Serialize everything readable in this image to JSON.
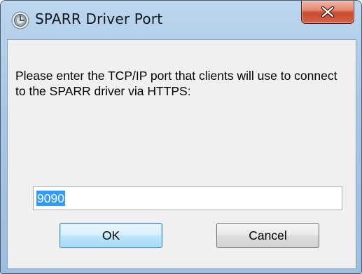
{
  "window": {
    "title": "SPARR Driver Port",
    "icon": "app-icon",
    "close_icon": "close-icon"
  },
  "dialog": {
    "prompt": "Please enter the TCP/IP port that clients will use to connect to the SPARR driver via HTTPS:",
    "port_value": "9090",
    "ok_label": "OK",
    "cancel_label": "Cancel"
  },
  "colors": {
    "title_bar": "#a8c6e4",
    "close_button": "#c64a2e",
    "selection": "#3399ff",
    "dialog_background": "#f0f0f0"
  }
}
